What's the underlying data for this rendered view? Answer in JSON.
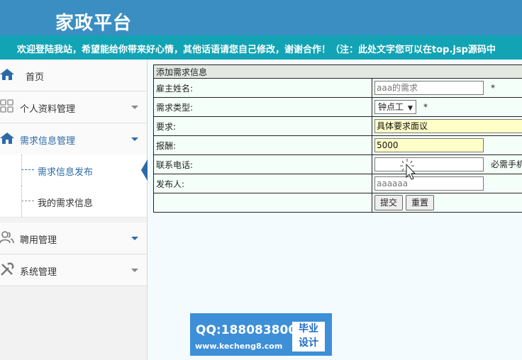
{
  "header": {
    "title": "家政平台"
  },
  "marquee": {
    "text": "欢迎登陆我站，希望能给你带来好心情，其他话语请您自己修改，谢谢合作！（注：此处文字您可以在top.jsp源码中"
  },
  "sidebar": {
    "home": "首页",
    "profile": "个人资料管理",
    "demand": "需求信息管理",
    "demand_publish": "需求信息发布",
    "my_demand": "我的需求信息",
    "hire": "聘用管理",
    "system": "系统管理"
  },
  "form": {
    "caption": "添加需求信息",
    "rows": {
      "employer_label": "雇主姓名:",
      "employer_value": "aaa的需求",
      "type_label": "需求类型:",
      "type_value": "钟点工",
      "req_label": "要求:",
      "req_value": "具体要求面议",
      "pay_label": "报酬:",
      "pay_value": "5000",
      "phone_label": "联系电话:",
      "phone_value": "",
      "phone_note": "必需手机",
      "publisher_label": "发布人:",
      "publisher_value": "aaaaaa"
    },
    "star": "*",
    "submit": "提交",
    "reset": "重置"
  },
  "watermark": {
    "qq": "QQ:188083800",
    "url": "www.kecheng8.com",
    "badge_line1": "毕业",
    "badge_line2": "设计"
  },
  "colors": {
    "header": "#3a8ec2",
    "marquee": "#12a3b5",
    "accent": "#2b6aa6"
  }
}
